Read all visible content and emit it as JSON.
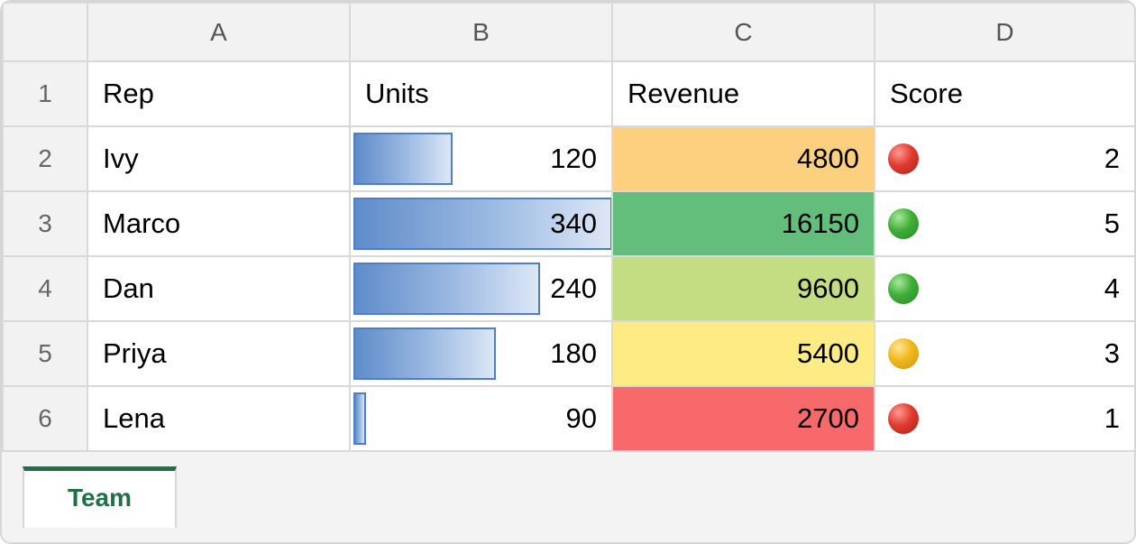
{
  "columns": [
    "A",
    "B",
    "C",
    "D"
  ],
  "header_row": {
    "num": "1",
    "rep": "Rep",
    "units": "Units",
    "revenue": "Revenue",
    "score": "Score"
  },
  "rows": [
    {
      "num": "2",
      "rep": "Ivy",
      "units": "120",
      "units_fraction": 0.353,
      "revenue": "4800",
      "revenue_color": "#fdd07f",
      "score": "2",
      "score_icon": "red-circle-icon"
    },
    {
      "num": "3",
      "rep": "Marco",
      "units": "340",
      "units_fraction": 1.0,
      "revenue": "16150",
      "revenue_color": "#63be7b",
      "score": "5",
      "score_icon": "green-circle-icon"
    },
    {
      "num": "4",
      "rep": "Dan",
      "units": "240",
      "units_fraction": 0.706,
      "revenue": "9600",
      "revenue_color": "#c4dc82",
      "score": "4",
      "score_icon": "green-circle-icon"
    },
    {
      "num": "5",
      "rep": "Priya",
      "units": "180",
      "units_fraction": 0.529,
      "revenue": "5400",
      "revenue_color": "#ffeb84",
      "score": "3",
      "score_icon": "yellow-circle-icon"
    },
    {
      "num": "6",
      "rep": "Lena",
      "units": "90",
      "units_fraction": 0.0,
      "revenue": "2700",
      "revenue_color": "#f8696b",
      "score": "1",
      "score_icon": "red-circle-icon"
    }
  ],
  "sheet_tabs": [
    {
      "label": "Team",
      "active": true
    }
  ],
  "colors": {
    "databar": "#5f8cca",
    "tab_accent": "#1f7145",
    "icon_red": "#e03b31",
    "icon_green": "#3fae37",
    "icon_yellow": "#f0b71c"
  }
}
